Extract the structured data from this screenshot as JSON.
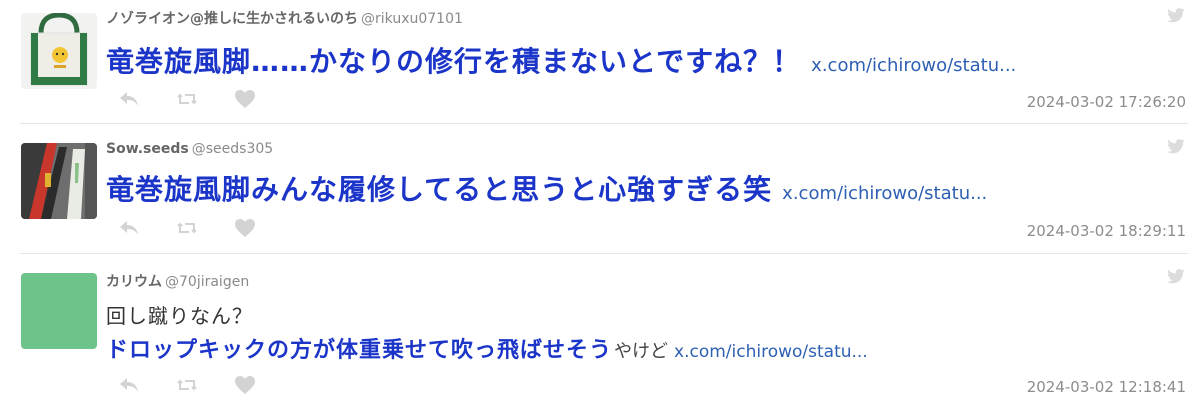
{
  "tweets": [
    {
      "display_name": "ノゾライオン@推しに生かされるいのち",
      "handle": "@rikuxu07101",
      "text": "竜巻旋風脚……かなりの修行を積まないとですね？！",
      "link": "x.com/ichirowo/statu...",
      "timestamp": "2024-03-02 17:26:20"
    },
    {
      "display_name": "Sow.seeds",
      "handle": "@seeds305",
      "text": "竜巻旋風脚みんな履修してると思うと心強すぎる笑",
      "link": "x.com/ichirowo/statu...",
      "timestamp": "2024-03-02 18:29:11"
    },
    {
      "display_name": "カリウム",
      "handle": "@70jiraigen",
      "text_line1": "回し蹴りなん？",
      "text_emphasis": "ドロップキックの方が体重乗せて吹っ飛ばせそう",
      "text_tail": "やけど",
      "link": "x.com/ichirowo/statu...",
      "timestamp": "2024-03-02 12:18:41"
    }
  ],
  "icons": {
    "reply": "reply-icon",
    "retweet": "retweet-icon",
    "like": "heart-icon",
    "brand": "twitter-bird-icon"
  },
  "colors": {
    "emphasis_text": "#1c35c9",
    "link": "#2d5fb3",
    "icon_gray": "#d3d3d3",
    "avatar_green": "#6cc48a"
  }
}
